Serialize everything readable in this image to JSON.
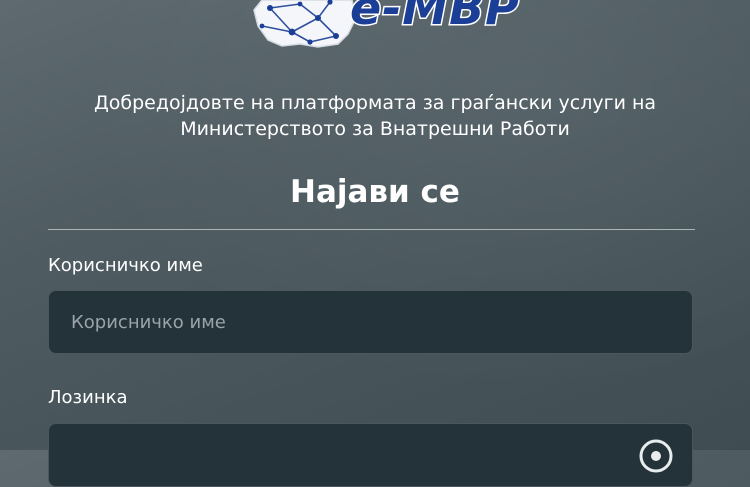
{
  "logo": {
    "text": "e-МВР",
    "colors": {
      "text": "#1b3f96",
      "network": "#1b3f96"
    }
  },
  "welcome": {
    "line1": "Добредојдовте на платформата за граѓански услуги на",
    "line2": "Министерството за Внатрешни Работи"
  },
  "form": {
    "title": "Најави се",
    "username": {
      "label": "Корисничко име",
      "placeholder": "Корисничко име",
      "value": ""
    },
    "password": {
      "label": "Лозинка",
      "placeholder": "",
      "value": "",
      "toggle_icon": "eye-icon"
    }
  },
  "colors": {
    "background": "#4f5c62",
    "field_background": "#243239",
    "text": "#ffffff"
  }
}
